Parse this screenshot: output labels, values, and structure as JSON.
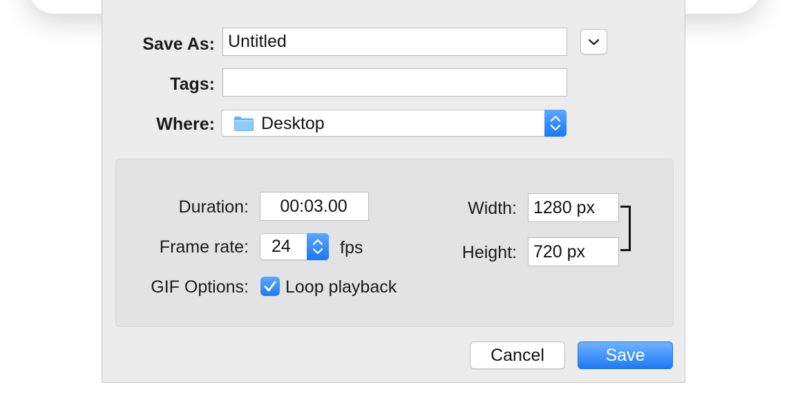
{
  "form": {
    "save_as_label": "Save As:",
    "save_as_value": "Untitled",
    "tags_label": "Tags:",
    "tags_value": "",
    "where_label": "Where:",
    "where_value": "Desktop",
    "expand_icon": "chevron-down-icon",
    "folder_icon": "folder-icon"
  },
  "options": {
    "duration_label": "Duration:",
    "duration_value": "00:03.00",
    "frame_rate_label": "Frame rate:",
    "frame_rate_value": "24",
    "frame_rate_unit": "fps",
    "gif_options_label": "GIF Options:",
    "loop_label": "Loop playback",
    "loop_checked": true,
    "width_label": "Width:",
    "width_value": "1280 px",
    "height_label": "Height:",
    "height_value": "720 px"
  },
  "buttons": {
    "cancel": "Cancel",
    "save": "Save"
  },
  "colors": {
    "accent": "#1e7af3",
    "sheet_background": "#ececec",
    "panel_background": "#e3e3e3"
  }
}
